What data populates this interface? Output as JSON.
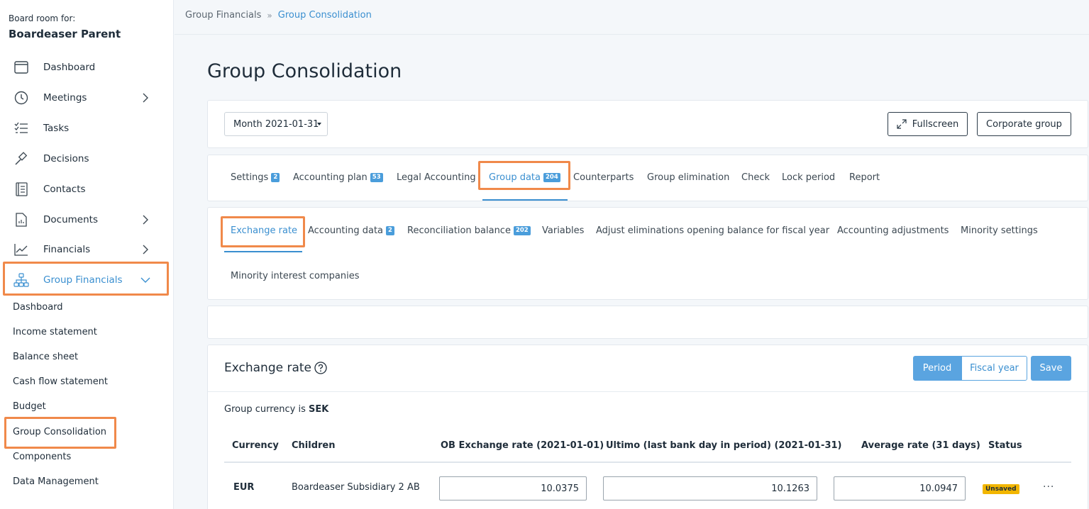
{
  "sidebar": {
    "room_label": "Board room for:",
    "room_name": "Boardeaser Parent",
    "items": [
      {
        "label": "Dashboard",
        "icon": "calendar-window-icon"
      },
      {
        "label": "Meetings",
        "icon": "clock-icon"
      },
      {
        "label": "Tasks",
        "icon": "checklist-icon"
      },
      {
        "label": "Decisions",
        "icon": "gavel-icon"
      },
      {
        "label": "Contacts",
        "icon": "address-book-icon"
      },
      {
        "label": "Documents",
        "icon": "document-icon"
      },
      {
        "label": "Financials",
        "icon": "line-chart-icon"
      },
      {
        "label": "Group Financials",
        "icon": "org-chart-icon"
      }
    ],
    "subitems": [
      "Dashboard",
      "Income statement",
      "Balance sheet",
      "Cash flow statement",
      "Budget",
      "Group Consolidation",
      "Components",
      "Data Management"
    ]
  },
  "breadcrumb": {
    "parent": "Group Financials",
    "separator": "»",
    "current": "Group Consolidation"
  },
  "page_title": "Group Consolidation",
  "toolbar": {
    "month_select": "Month 2021-01-31",
    "fullscreen": "Fullscreen",
    "corporate_group": "Corporate group"
  },
  "main_tabs": [
    {
      "label": "Settings",
      "badge": "2"
    },
    {
      "label": "Accounting plan",
      "badge": "53"
    },
    {
      "label": "Legal Accounting"
    },
    {
      "label": "Group data",
      "badge": "204",
      "active": true
    },
    {
      "label": "Counterparts"
    },
    {
      "label": "Group elimination"
    },
    {
      "label": "Check"
    },
    {
      "label": "Lock period"
    },
    {
      "label": "Report"
    }
  ],
  "sub_tabs": [
    {
      "label": "Exchange rate",
      "active": true
    },
    {
      "label": "Accounting data",
      "badge": "2"
    },
    {
      "label": "Reconciliation balance",
      "badge": "202"
    },
    {
      "label": "Variables"
    },
    {
      "label": "Adjust eliminations opening balance for fiscal year"
    },
    {
      "label": "Accounting adjustments"
    },
    {
      "label": "Minority settings"
    },
    {
      "label": "Minority interest companies"
    }
  ],
  "exchange": {
    "title": "Exchange rate",
    "period": "Period",
    "fiscal_year": "Fiscal year",
    "save": "Save",
    "currency_prefix": "Group currency is",
    "currency": "SEK",
    "columns": [
      "Currency",
      "Children",
      "OB Exchange rate (2021-01-01)",
      "Ultimo (last bank day in period) (2021-01-31)",
      "Average rate (31 days)",
      "Status"
    ],
    "rows": [
      {
        "currency": "EUR",
        "children": "Boardeaser  Subsidiary  2  AB",
        "ob_rate": "10.0375",
        "ultimo": "10.1263",
        "average": "10.0947",
        "status": "Unsaved",
        "more": "···"
      }
    ]
  },
  "colors": {
    "accent": "#3a8fd0",
    "highlight": "#f0894a",
    "unsaved": "#f2b600"
  }
}
